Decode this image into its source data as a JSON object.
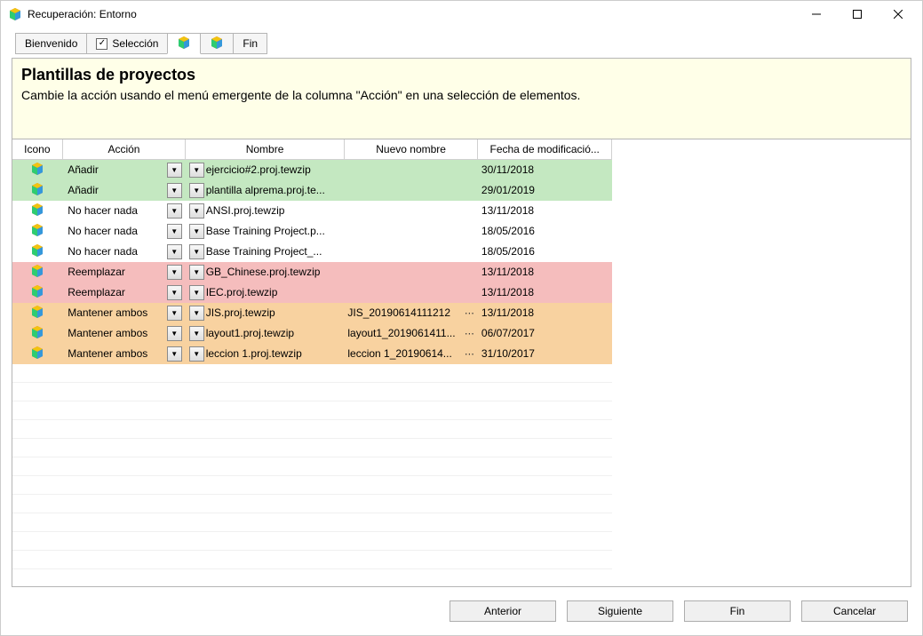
{
  "window": {
    "title": "Recuperación: Entorno"
  },
  "tabs": {
    "welcome": "Bienvenido",
    "selection": "Selección",
    "end": "Fin"
  },
  "header": {
    "title": "Plantillas de proyectos",
    "subtitle": "Cambie la acción usando el menú emergente de la columna \"Acción\" en una selección de elementos."
  },
  "columns": {
    "icon": "Icono",
    "action": "Acción",
    "name": "Nombre",
    "newname": "Nuevo nombre",
    "date": "Fecha de modificació..."
  },
  "rows": [
    {
      "type": "add",
      "action": "Añadir",
      "name": "ejercicio#2.proj.tewzip",
      "newname": "",
      "date": "30/11/2018"
    },
    {
      "type": "add",
      "action": "Añadir",
      "name": "plantilla alprema.proj.te...",
      "newname": "",
      "date": "29/01/2019"
    },
    {
      "type": "none",
      "action": "No hacer nada",
      "name": "ANSI.proj.tewzip",
      "newname": "",
      "date": "13/11/2018"
    },
    {
      "type": "none",
      "action": "No hacer nada",
      "name": "Base Training Project.p...",
      "newname": "",
      "date": "18/05/2016"
    },
    {
      "type": "none",
      "action": "No hacer nada",
      "name": "Base Training Project_...",
      "newname": "",
      "date": "18/05/2016"
    },
    {
      "type": "replace",
      "action": "Reemplazar",
      "name": "GB_Chinese.proj.tewzip",
      "newname": "",
      "date": "13/11/2018"
    },
    {
      "type": "replace",
      "action": "Reemplazar",
      "name": "IEC.proj.tewzip",
      "newname": "",
      "date": "13/11/2018"
    },
    {
      "type": "keep",
      "action": "Mantener ambos",
      "name": "JIS.proj.tewzip",
      "newname": "JIS_20190614111212",
      "date": "13/11/2018"
    },
    {
      "type": "keep",
      "action": "Mantener ambos",
      "name": "layout1.proj.tewzip",
      "newname": "layout1_2019061411...",
      "date": "06/07/2017"
    },
    {
      "type": "keep",
      "action": "Mantener ambos",
      "name": "leccion 1.proj.tewzip",
      "newname": "leccion 1_20190614...",
      "date": "31/10/2017"
    }
  ],
  "footer": {
    "prev": "Anterior",
    "next": "Siguiente",
    "end": "Fin",
    "cancel": "Cancelar"
  }
}
